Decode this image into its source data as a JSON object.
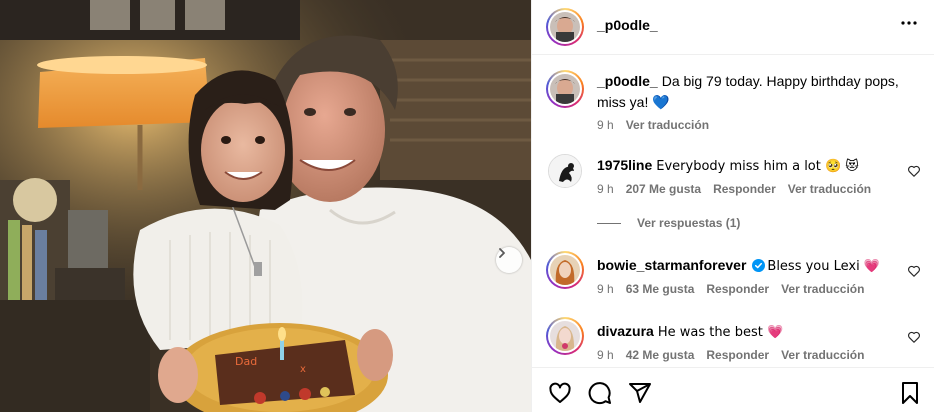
{
  "post": {
    "username": "_p0odle_",
    "caption": "Da big 79 today. Happy birthday pops, miss ya! 💙",
    "caption_time": "9 h",
    "caption_translate": "Ver traducción"
  },
  "comments": [
    {
      "username": "1975line",
      "text": "Everybody miss him a lot 🥺 😻",
      "time": "9 h",
      "likes": "207 Me gusta",
      "reply": "Responder",
      "translate": "Ver traducción",
      "verified": false
    },
    {
      "username": "bowie_starmanforever",
      "text": "Bless you Lexi 💗",
      "time": "9 h",
      "likes": "63 Me gusta",
      "reply": "Responder",
      "translate": "Ver traducción",
      "verified": true
    },
    {
      "username": "divazura",
      "text": "He was the best 💗",
      "time": "9 h",
      "likes": "42 Me gusta",
      "reply": "Responder",
      "translate": "Ver traducción",
      "verified": false
    }
  ],
  "view_replies": "Ver respuestas (1)",
  "colors": {
    "verified_blue": "#0095f6",
    "meta_grey": "#737373",
    "divider": "#efefef"
  },
  "icons": [
    "more-options-icon",
    "like-icon",
    "comment-icon",
    "share-icon",
    "save-icon",
    "chevron-right-icon",
    "verified-icon"
  ]
}
